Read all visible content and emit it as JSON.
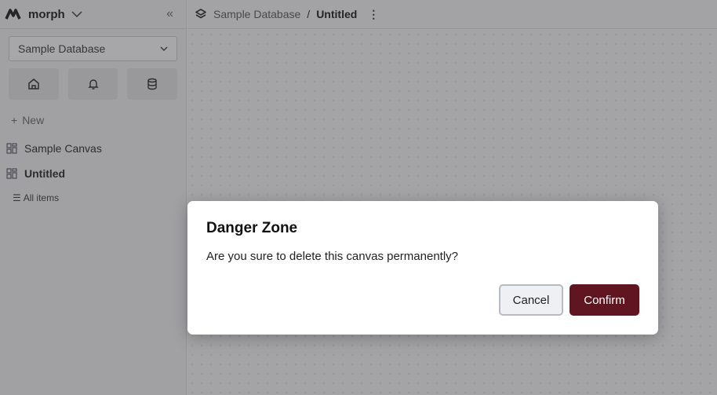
{
  "sidebar": {
    "brand": "morph",
    "database": "Sample Database",
    "new_label": "New",
    "items": [
      {
        "label": "Sample Canvas"
      },
      {
        "label": "Untitled"
      }
    ],
    "all_items": "All items"
  },
  "topbar": {
    "crumb_db": "Sample Database",
    "separator": "/",
    "crumb_page": "Untitled"
  },
  "dialog": {
    "title": "Danger Zone",
    "message": "Are you sure to delete this canvas permanently?",
    "cancel": "Cancel",
    "confirm": "Confirm",
    "confirm_color": "#5f1621"
  }
}
